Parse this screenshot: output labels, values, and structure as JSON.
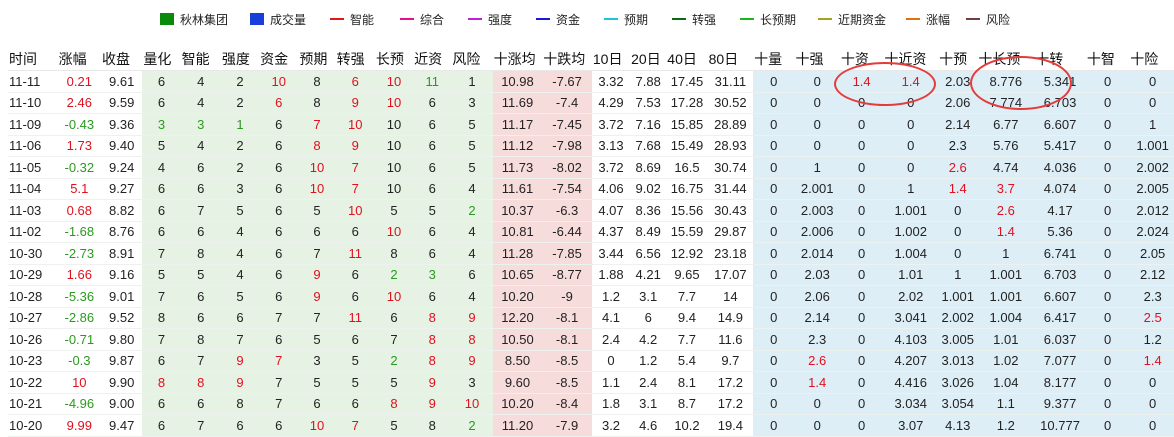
{
  "legend": [
    {
      "label": "秋林集团",
      "color": "#0a8a0a",
      "kind": "box"
    },
    {
      "label": "成交量",
      "color": "#1840d8",
      "kind": "box"
    },
    {
      "label": "智能",
      "color": "#e01818",
      "kind": "line"
    },
    {
      "label": "综合",
      "color": "#e8108a",
      "kind": "line"
    },
    {
      "label": "强度",
      "color": "#c020d0",
      "kind": "line"
    },
    {
      "label": "资金",
      "color": "#1818d8",
      "kind": "line"
    },
    {
      "label": "预期",
      "color": "#18c8d8",
      "kind": "line"
    },
    {
      "label": "转强",
      "color": "#0a6a18",
      "kind": "line"
    },
    {
      "label": "长预期",
      "color": "#18b818",
      "kind": "line"
    },
    {
      "label": "近期资金",
      "color": "#a8a020",
      "kind": "line"
    },
    {
      "label": "涨幅",
      "color": "#e07010",
      "kind": "line"
    },
    {
      "label": "风险",
      "color": "#704040",
      "kind": "line"
    }
  ],
  "table": {
    "headers": [
      "时间",
      "涨幅",
      "收盘",
      "量化",
      "智能",
      "强度",
      "资金",
      "预期",
      "转强",
      "长预",
      "近资",
      "风险",
      "十涨均",
      "十跌均",
      "10日",
      "20日",
      "40日",
      "80日",
      "十量",
      "十强",
      "十资",
      "十近资",
      "十预",
      "十长预",
      "十转",
      "十智",
      "十险"
    ],
    "rows": [
      {
        "cells": [
          "11-11",
          "0.21",
          "9.61",
          "6",
          "4",
          "2",
          "10",
          "8",
          "6",
          "10",
          "11",
          "1",
          "10.98",
          "-7.67",
          "3.32",
          "7.88",
          "17.45",
          "31.11",
          "0",
          "0",
          "1.4",
          "1.4",
          "2.03",
          "8.776",
          "5.341",
          "0",
          "0"
        ],
        "chg": "up",
        "red": [
          1,
          6,
          8,
          9,
          20,
          21
        ],
        "green": [
          10
        ]
      },
      {
        "cells": [
          "11-10",
          "2.46",
          "9.59",
          "6",
          "4",
          "2",
          "6",
          "8",
          "9",
          "10",
          "6",
          "3",
          "11.69",
          "-7.4",
          "4.29",
          "7.53",
          "17.28",
          "30.52",
          "0",
          "0",
          "0",
          "0",
          "2.06",
          "7.774",
          "6.703",
          "0",
          "0"
        ],
        "chg": "up",
        "red": [
          1,
          6,
          8,
          9
        ],
        "green": []
      },
      {
        "cells": [
          "11-09",
          "-0.43",
          "9.36",
          "3",
          "3",
          "1",
          "6",
          "7",
          "10",
          "10",
          "6",
          "5",
          "11.17",
          "-7.45",
          "3.72",
          "7.16",
          "15.85",
          "28.89",
          "0",
          "0",
          "0",
          "0",
          "2.14",
          "6.77",
          "6.607",
          "0",
          "1"
        ],
        "chg": "down",
        "red": [
          7,
          8
        ],
        "green": [
          3,
          4,
          5
        ]
      },
      {
        "cells": [
          "11-06",
          "1.73",
          "9.40",
          "5",
          "4",
          "2",
          "6",
          "8",
          "9",
          "10",
          "6",
          "5",
          "11.12",
          "-7.98",
          "3.13",
          "7.68",
          "15.49",
          "28.93",
          "0",
          "0",
          "0",
          "0",
          "2.3",
          "5.76",
          "5.417",
          "0",
          "1.001"
        ],
        "chg": "up",
        "red": [
          7,
          8
        ],
        "green": []
      },
      {
        "cells": [
          "11-05",
          "-0.32",
          "9.24",
          "4",
          "6",
          "2",
          "6",
          "10",
          "7",
          "10",
          "6",
          "5",
          "11.73",
          "-8.02",
          "3.72",
          "8.69",
          "16.5",
          "30.74",
          "0",
          "1",
          "0",
          "0",
          "2.6",
          "4.74",
          "4.036",
          "0",
          "2.002"
        ],
        "chg": "down",
        "red": [
          7,
          8,
          22
        ],
        "green": []
      },
      {
        "cells": [
          "11-04",
          "5.1",
          "9.27",
          "6",
          "6",
          "3",
          "6",
          "10",
          "7",
          "10",
          "6",
          "4",
          "11.61",
          "-7.54",
          "4.06",
          "9.02",
          "16.75",
          "31.44",
          "0",
          "2.001",
          "0",
          "1",
          "1.4",
          "3.7",
          "4.074",
          "0",
          "2.005"
        ],
        "chg": "up",
        "red": [
          7,
          8,
          22,
          23
        ],
        "green": []
      },
      {
        "cells": [
          "11-03",
          "0.68",
          "8.82",
          "6",
          "7",
          "5",
          "6",
          "5",
          "10",
          "5",
          "5",
          "2",
          "10.37",
          "-6.3",
          "4.07",
          "8.36",
          "15.56",
          "30.43",
          "0",
          "2.003",
          "0",
          "1.001",
          "0",
          "2.6",
          "4.17",
          "0",
          "2.012"
        ],
        "chg": "up",
        "red": [
          8,
          23
        ],
        "green": [
          11
        ]
      },
      {
        "cells": [
          "11-02",
          "-1.68",
          "8.76",
          "6",
          "6",
          "4",
          "6",
          "6",
          "6",
          "10",
          "6",
          "4",
          "10.81",
          "-6.44",
          "4.37",
          "8.49",
          "15.59",
          "29.87",
          "0",
          "2.006",
          "0",
          "1.002",
          "0",
          "1.4",
          "5.36",
          "0",
          "2.024"
        ],
        "chg": "down",
        "red": [
          9,
          23
        ],
        "green": []
      },
      {
        "cells": [
          "10-30",
          "-2.73",
          "8.91",
          "7",
          "8",
          "4",
          "6",
          "7",
          "11",
          "8",
          "6",
          "4",
          "11.28",
          "-7.85",
          "3.44",
          "6.56",
          "12.92",
          "23.18",
          "0",
          "2.014",
          "0",
          "1.004",
          "0",
          "1",
          "6.741",
          "0",
          "2.05"
        ],
        "chg": "down",
        "red": [
          8
        ],
        "green": []
      },
      {
        "cells": [
          "10-29",
          "1.66",
          "9.16",
          "5",
          "5",
          "4",
          "6",
          "9",
          "6",
          "2",
          "3",
          "6",
          "10.65",
          "-8.77",
          "1.88",
          "4.21",
          "9.65",
          "17.07",
          "0",
          "2.03",
          "0",
          "1.01",
          "1",
          "1.001",
          "6.703",
          "0",
          "2.12"
        ],
        "chg": "up",
        "red": [
          7
        ],
        "green": [
          9,
          10
        ]
      },
      {
        "cells": [
          "10-28",
          "-5.36",
          "9.01",
          "7",
          "6",
          "5",
          "6",
          "9",
          "6",
          "10",
          "6",
          "4",
          "10.20",
          "-9",
          "1.2",
          "3.1",
          "7.7",
          "14",
          "0",
          "2.06",
          "0",
          "2.02",
          "1.001",
          "1.001",
          "6.607",
          "0",
          "2.3"
        ],
        "chg": "down",
        "red": [
          7,
          9
        ],
        "green": []
      },
      {
        "cells": [
          "10-27",
          "-2.86",
          "9.52",
          "8",
          "6",
          "6",
          "7",
          "7",
          "11",
          "6",
          "8",
          "9",
          "12.20",
          "-8.1",
          "4.1",
          "6",
          "9.4",
          "14.9",
          "0",
          "2.14",
          "0",
          "3.041",
          "2.002",
          "1.004",
          "6.417",
          "0",
          "2.5"
        ],
        "chg": "down",
        "red": [
          8,
          10,
          11,
          26
        ],
        "green": []
      },
      {
        "cells": [
          "10-26",
          "-0.71",
          "9.80",
          "7",
          "8",
          "7",
          "6",
          "5",
          "6",
          "7",
          "8",
          "8",
          "10.50",
          "-8.1",
          "2.4",
          "4.2",
          "7.7",
          "11.6",
          "0",
          "2.3",
          "0",
          "4.103",
          "3.005",
          "1.01",
          "6.037",
          "0",
          "1.2"
        ],
        "chg": "down",
        "red": [
          10,
          11
        ],
        "green": []
      },
      {
        "cells": [
          "10-23",
          "-0.3",
          "9.87",
          "6",
          "7",
          "9",
          "7",
          "3",
          "5",
          "2",
          "8",
          "9",
          "8.50",
          "-8.5",
          "0",
          "1.2",
          "5.4",
          "9.7",
          "0",
          "2.6",
          "0",
          "4.207",
          "3.013",
          "1.02",
          "7.077",
          "0",
          "1.4"
        ],
        "chg": "down",
        "red": [
          5,
          6,
          10,
          11,
          19,
          26
        ],
        "green": [
          9
        ]
      },
      {
        "cells": [
          "10-22",
          "10",
          "9.90",
          "8",
          "8",
          "9",
          "7",
          "5",
          "5",
          "5",
          "9",
          "3",
          "9.60",
          "-8.5",
          "1.1",
          "2.4",
          "8.1",
          "17.2",
          "0",
          "1.4",
          "0",
          "4.416",
          "3.026",
          "1.04",
          "8.177",
          "0",
          "0"
        ],
        "chg": "up",
        "red": [
          3,
          4,
          5,
          10,
          19
        ],
        "green": []
      },
      {
        "cells": [
          "10-21",
          "-4.96",
          "9.00",
          "6",
          "6",
          "8",
          "7",
          "6",
          "6",
          "8",
          "9",
          "10",
          "10.20",
          "-8.4",
          "1.8",
          "3.1",
          "8.7",
          "17.2",
          "0",
          "0",
          "0",
          "3.034",
          "3.054",
          "1.1",
          "9.377",
          "0",
          "0"
        ],
        "chg": "down",
        "red": [
          9,
          10,
          11
        ],
        "green": []
      },
      {
        "cells": [
          "10-20",
          "9.99",
          "9.47",
          "6",
          "7",
          "6",
          "6",
          "10",
          "7",
          "5",
          "8",
          "2",
          "11.20",
          "-7.9",
          "3.2",
          "4.6",
          "10.2",
          "19.4",
          "0",
          "0",
          "0",
          "3.07",
          "4.13",
          "1.2",
          "10.777",
          "0",
          "0"
        ],
        "chg": "up",
        "red": [
          7,
          8
        ],
        "green": [
          11
        ]
      }
    ]
  },
  "colors": {
    "red": "#e0101e",
    "green": "#2a9a1e",
    "annotation": "#e43b3b"
  }
}
